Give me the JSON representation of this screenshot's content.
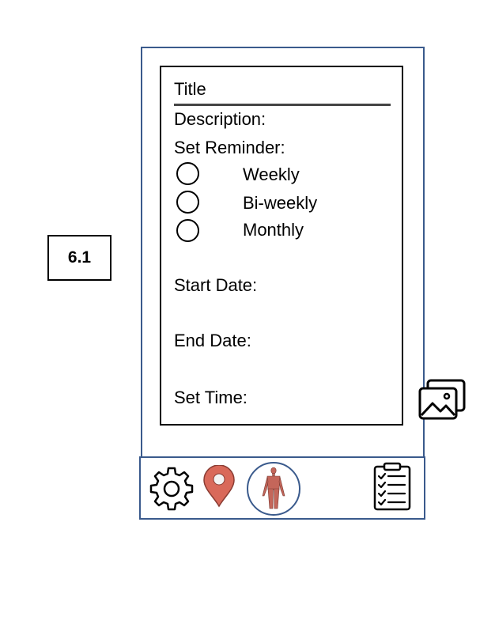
{
  "screen_label": "6.1",
  "form": {
    "title_label": "Title",
    "description_label": "Description:",
    "reminder_label": "Set Reminder:",
    "reminder_options": [
      "Weekly",
      "Bi-weekly",
      "Monthly"
    ],
    "start_date_label": "Start Date:",
    "end_date_label": "End Date:",
    "set_time_label": "Set Time:"
  },
  "icons": {
    "gallery": "image-gallery-icon",
    "settings": "gear-icon",
    "location": "map-pin-icon",
    "body": "human-body-icon",
    "tasks": "clipboard-checklist-icon"
  },
  "colors": {
    "frame_border": "#3a5a8c",
    "pin": "#d9695a",
    "body_circle": "#3a5a8c"
  }
}
